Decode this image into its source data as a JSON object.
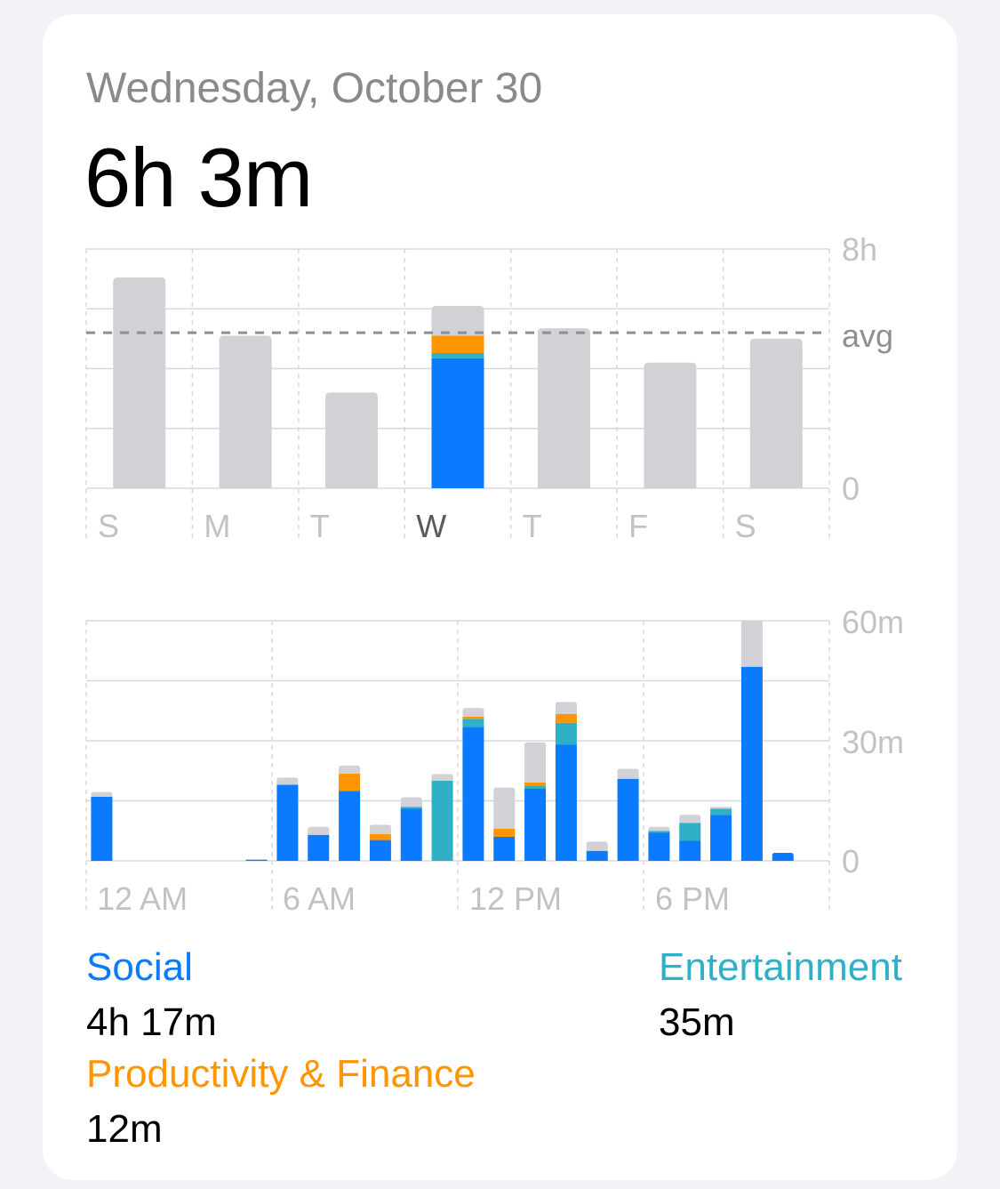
{
  "header": {
    "date": "Wednesday, October 30",
    "total": "6h 3m"
  },
  "colors": {
    "social": "#0a7aff",
    "entertainment": "#30b0c7",
    "productivity": "#ff9500",
    "other": "#d1d1d6",
    "grid": "#d8d8dc",
    "axis_label": "#c2c2c6",
    "selected_label": "#5a5a5e",
    "avg_line": "#8e8e93"
  },
  "weekly": {
    "y_labels": [
      "8h",
      "0"
    ],
    "avg_label": "avg",
    "days": [
      "S",
      "M",
      "T",
      "W",
      "T",
      "F",
      "S"
    ],
    "selected_index": 3,
    "average_hours": 5.2
  },
  "hourly": {
    "y_labels": [
      "60m",
      "30m",
      "0"
    ],
    "x_labels": [
      "12 AM",
      "6 AM",
      "12 PM",
      "6 PM"
    ]
  },
  "categories": [
    {
      "name": "Social",
      "value": "4h 17m",
      "color": "#0a7aff"
    },
    {
      "name": "Entertainment",
      "value": "35m",
      "color": "#30b0c7"
    },
    {
      "name": "Productivity & Finance",
      "value": "12m",
      "color": "#ff9500"
    }
  ],
  "chart_data": [
    {
      "type": "bar",
      "stacked": true,
      "categories": [
        "S",
        "M",
        "T",
        "W",
        "T",
        "F",
        "S"
      ],
      "series": [
        {
          "name": "Social",
          "values": [
            0,
            0,
            0,
            4.35,
            0,
            0,
            0
          ]
        },
        {
          "name": "Entertainment",
          "values": [
            0,
            0,
            0,
            0.17,
            0,
            0,
            0
          ]
        },
        {
          "name": "Productivity & Finance",
          "values": [
            0,
            0,
            0,
            0.58,
            0,
            0,
            0
          ]
        },
        {
          "values": [
            7.05,
            5.1,
            3.2,
            1.0,
            5.35,
            4.2,
            5.0
          ]
        }
      ],
      "ylim": [
        0,
        8
      ],
      "unit": "hours",
      "reference_line": {
        "label": "avg",
        "value": 5.2
      },
      "grid": true
    },
    {
      "type": "bar",
      "stacked": true,
      "categories": [
        "12 AM",
        "1 AM",
        "2 AM",
        "3 AM",
        "4 AM",
        "5 AM",
        "6 AM",
        "7 AM",
        "8 AM",
        "9 AM",
        "10 AM",
        "11 AM",
        "12 PM",
        "1 PM",
        "2 PM",
        "3 PM",
        "4 PM",
        "5 PM",
        "6 PM",
        "7 PM",
        "8 PM",
        "9 PM",
        "10 PM",
        "11 PM"
      ],
      "series": [
        {
          "name": "Social",
          "values": [
            16,
            0,
            0,
            0,
            0,
            0.3,
            19,
            6.5,
            17.5,
            5.2,
            13,
            0,
            33.5,
            6,
            18,
            29,
            2.5,
            20.5,
            7,
            5,
            11.5,
            48.5,
            2,
            0
          ]
        },
        {
          "name": "Entertainment",
          "values": [
            0,
            0,
            0,
            0,
            0,
            0,
            0,
            0,
            0,
            0,
            0.5,
            20,
            2,
            0,
            0.8,
            5.5,
            0,
            0,
            0.5,
            4.5,
            1.5,
            0,
            0,
            0
          ]
        },
        {
          "name": "Productivity & Finance",
          "values": [
            0,
            0,
            0,
            0,
            0,
            0,
            0,
            0,
            4.3,
            1.5,
            0,
            0,
            0.5,
            2,
            0.8,
            2.2,
            0,
            0,
            0,
            0,
            0,
            0,
            0,
            0
          ]
        },
        {
          "values": [
            1.2,
            0,
            0,
            0,
            0,
            0,
            1.8,
            2,
            2,
            2.3,
            2.4,
            1.7,
            2.2,
            10.3,
            10,
            3,
            2.3,
            2.5,
            1,
            2,
            0.5,
            11.5,
            0,
            0
          ]
        }
      ],
      "ylim": [
        0,
        60
      ],
      "unit": "minutes",
      "grid": true
    }
  ]
}
